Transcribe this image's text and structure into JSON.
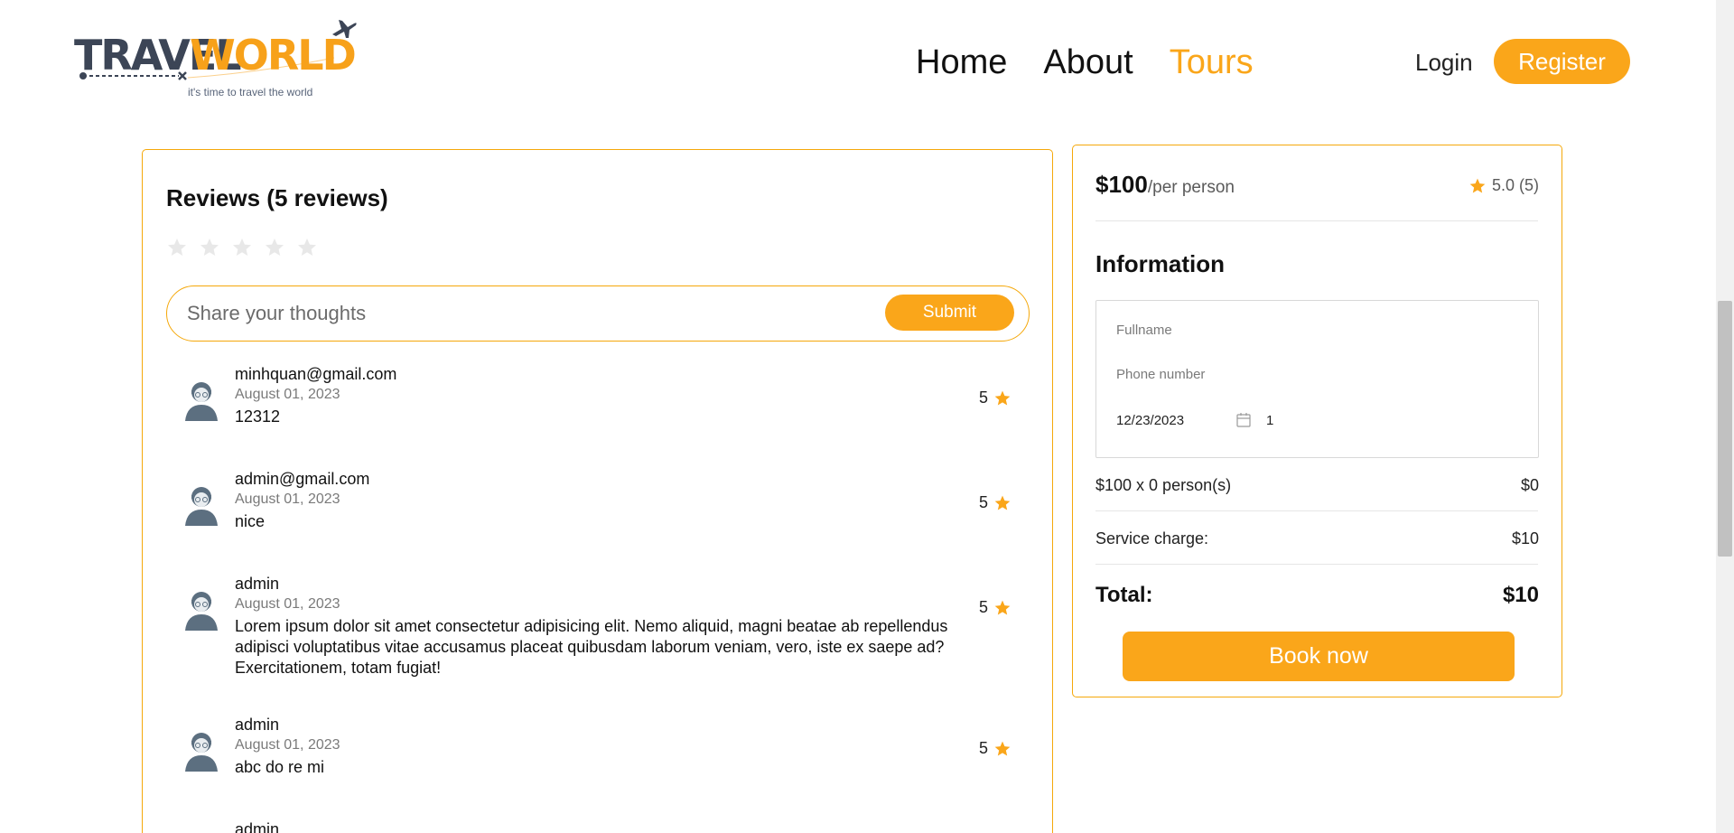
{
  "brand": {
    "word1": "TRAVEL",
    "word2": "WORLD",
    "tagline": "it's time to travel the world",
    "colors": {
      "dark": "#3c4556",
      "accent": "#f7a11a"
    },
    "icon": "plane-icon"
  },
  "nav": {
    "items": [
      "Home",
      "About",
      "Tours"
    ],
    "active": "Tours"
  },
  "auth": {
    "login": "Login",
    "register": "Register"
  },
  "reviews": {
    "title": "Reviews (5 reviews)",
    "rating_input_stars": 5,
    "input_placeholder": "Share your thoughts",
    "submit_label": "Submit",
    "items": [
      {
        "user": "minhquan@gmail.com",
        "date": "August 01, 2023",
        "text": "12312",
        "rating": "5"
      },
      {
        "user": "admin@gmail.com",
        "date": "August 01, 2023",
        "text": "nice",
        "rating": "5"
      },
      {
        "user": "admin",
        "date": "August 01, 2023",
        "text": "Lorem ipsum dolor sit amet consectetur adipisicing elit. Nemo aliquid, magni beatae ab repellendus adipisci voluptatibus vitae accusamus placeat quibusdam laborum veniam, vero, iste ex saepe ad? Exercitationem, totam fugiat!",
        "rating": "5"
      },
      {
        "user": "admin",
        "date": "August 01, 2023",
        "text": "abc do re mi",
        "rating": "5"
      },
      {
        "user": "admin",
        "date": "",
        "text": "",
        "rating": ""
      }
    ]
  },
  "booking": {
    "price": "$100",
    "per_person": "/per person",
    "rating_summary": "5.0 (5)",
    "info_title": "Information",
    "fullname_placeholder": "Fullname",
    "phone_placeholder": "Phone number",
    "date_value": "12/23/2023",
    "guests_value": "1",
    "price_line_label": "$100 x 0 person(s)",
    "price_line_value": "$0",
    "service_label": "Service charge:",
    "service_value": "$10",
    "total_label": "Total:",
    "total_value": "$10",
    "book_label": "Book now"
  },
  "colors": {
    "accent": "#faa61a",
    "border": "#f5a80a",
    "star_empty": "#e8e8e8"
  }
}
